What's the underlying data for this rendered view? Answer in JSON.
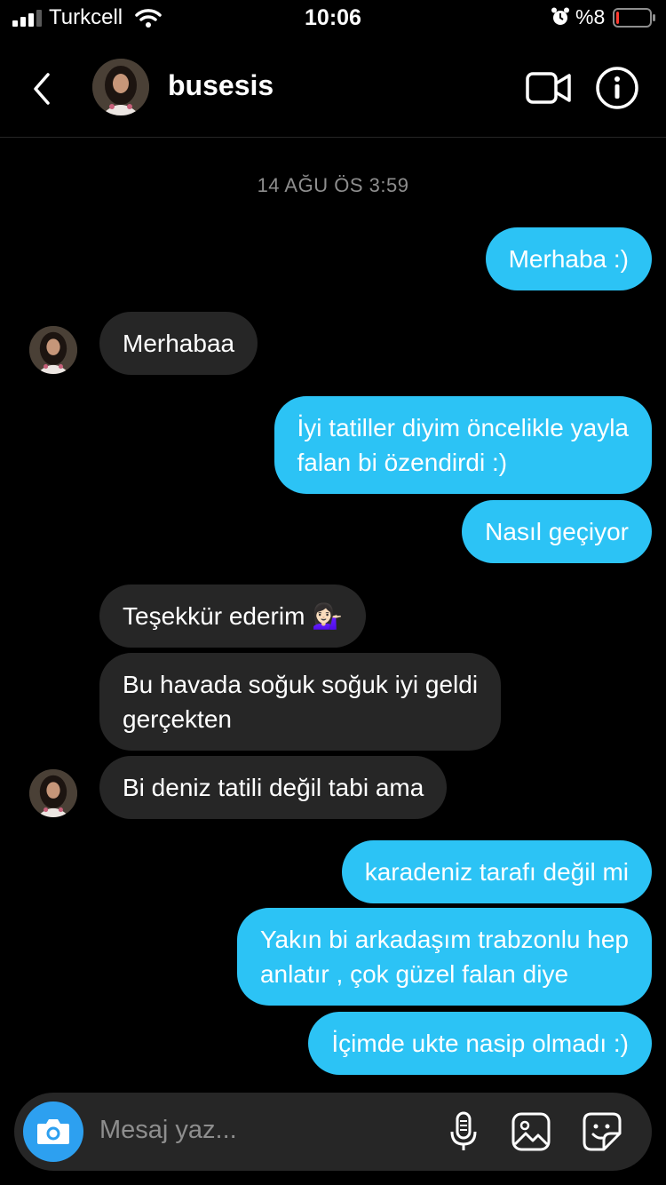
{
  "status_bar": {
    "carrier": "Turkcell",
    "time": "10:06",
    "battery_percent": "%8",
    "battery_level": 0.08,
    "icons": [
      "signal-icon",
      "wifi-icon",
      "alarm-icon",
      "battery-icon"
    ]
  },
  "header": {
    "username": "busesis",
    "icons": [
      "back-arrow-icon",
      "video-call-icon",
      "info-icon"
    ]
  },
  "chat": {
    "timestamp": "14 AĞU ÖS 3:59",
    "messages": [
      {
        "sender": "me",
        "text": "Merhaba :)"
      },
      {
        "sender": "them",
        "text": "Merhabaa"
      },
      {
        "sender": "me",
        "text": "İyi tatiller diyim öncelikle yayla\nfalan bi özendirdi :)"
      },
      {
        "sender": "me",
        "text": "Nasıl geçiyor"
      },
      {
        "sender": "them",
        "text": "Teşekkür ederim 💁🏻‍♀️"
      },
      {
        "sender": "them",
        "text": "Bu havada soğuk soğuk iyi geldi\ngerçekten"
      },
      {
        "sender": "them",
        "text": "Bi deniz tatili değil tabi ama"
      },
      {
        "sender": "me",
        "text": "karadeniz tarafı değil mi"
      },
      {
        "sender": "me",
        "text": "Yakın bi arkadaşım trabzonlu hep\nanlatır , çok güzel falan diye"
      },
      {
        "sender": "me",
        "text": "İçimde ukte nasip olmadı :)"
      }
    ]
  },
  "composer": {
    "placeholder": "Mesaj yaz...",
    "icons": [
      "camera-icon",
      "microphone-icon",
      "gallery-icon",
      "sticker-icon"
    ]
  },
  "colors": {
    "background": "#000000",
    "outgoing_bubble": "#2cc3f5",
    "incoming_bubble": "#262626",
    "camera_button": "#2da0f0",
    "muted_text": "#8e8e8e",
    "battery_low": "#ff3b30"
  }
}
